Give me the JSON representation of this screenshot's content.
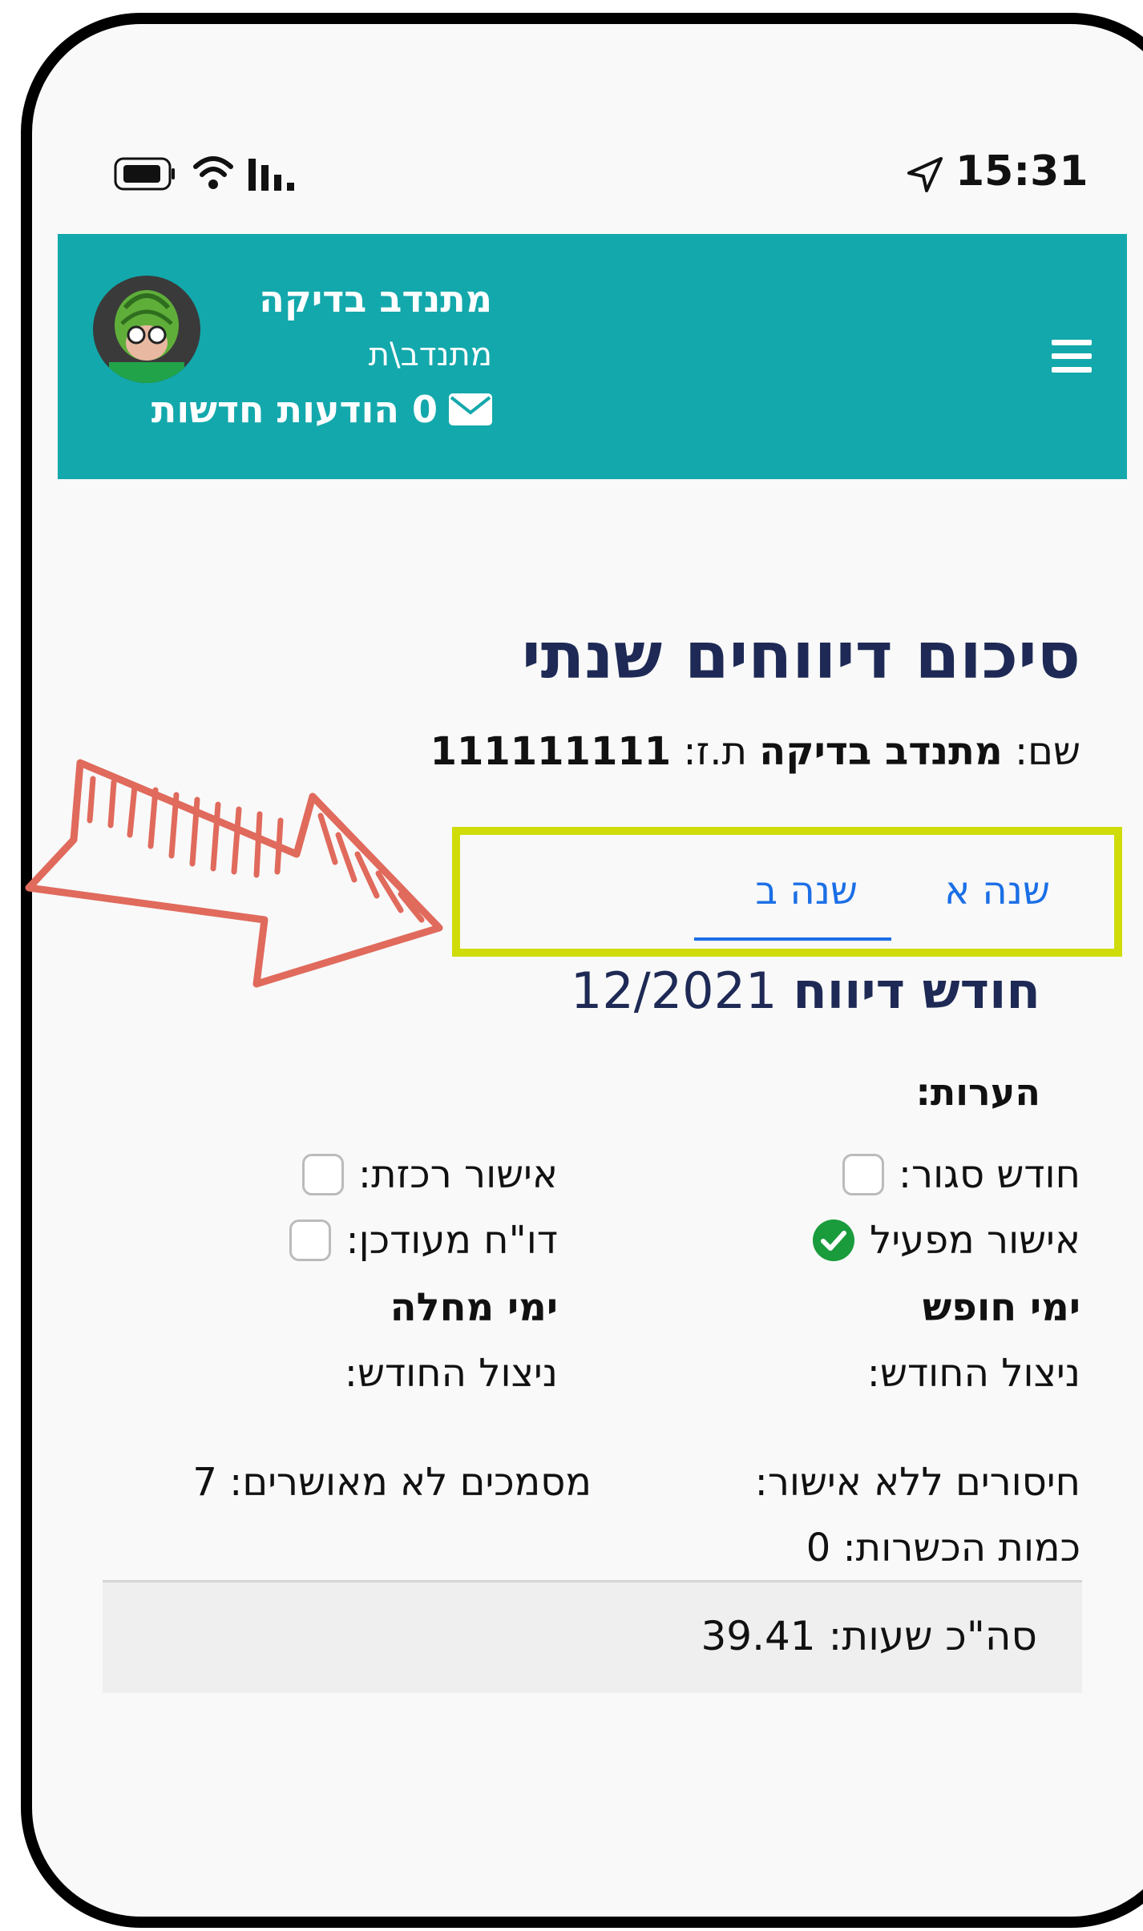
{
  "status_bar": {
    "time": "15:31"
  },
  "header": {
    "user_name": "מתנדב בדיקה",
    "user_role": "מתנדב\\ת",
    "messages": "0 הודעות חדשות"
  },
  "page": {
    "title": "סיכום דיווחים שנתי",
    "name_label": "שם:",
    "name_value": "מתנדב בדיקה",
    "id_label": "ת.ז:",
    "id_value": "111111111"
  },
  "tabs": [
    {
      "label": "שנה א",
      "active": false
    },
    {
      "label": "שנה ב",
      "active": true
    }
  ],
  "report": {
    "month_label": "חודש דיווח",
    "month_value": "12/2021",
    "notes_label": "הערות:",
    "closed_month": "חודש סגור:",
    "coordinator_approval": "אישור רכזת:",
    "operator_approval": "אישור מפעיל",
    "updated_report": "דו\"ח מעודכן:",
    "vacation_days": "ימי חופש",
    "sick_days": "ימי מחלה",
    "vacation_usage": "ניצול החודש:",
    "sick_usage": "ניצול החודש:",
    "unapproved_absences": "חיסורים ללא אישור:",
    "unapproved_docs": "מסמכים לא מאושרים: 7",
    "trainings": "כמות הכשרות: 0",
    "total_hours": "סה\"כ שעות: 39.41"
  },
  "colors": {
    "header_bg": "#13a8ac",
    "title": "#1e2a55",
    "tab_active": "#1b6fe6",
    "highlight_box": "#cfdc0a",
    "arrow": "#e06a5c",
    "check": "#1a9b3c"
  }
}
